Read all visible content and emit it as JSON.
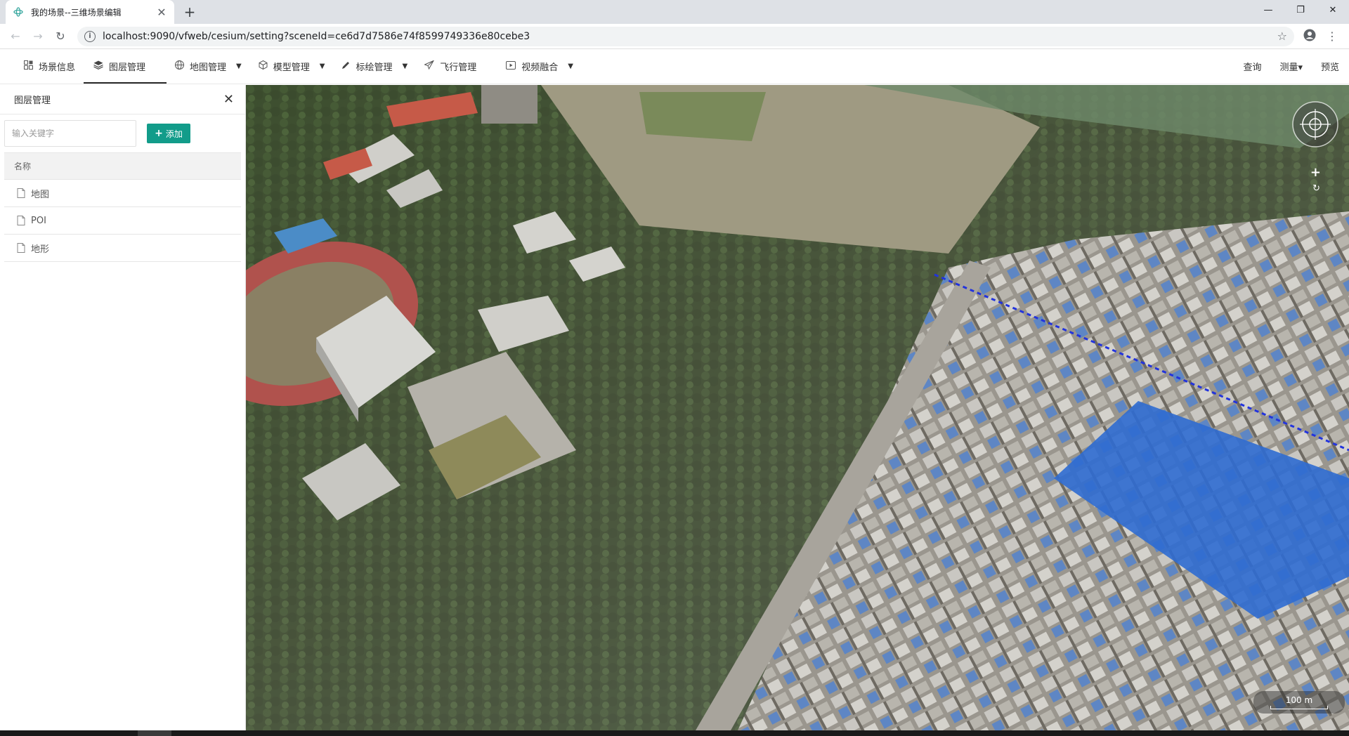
{
  "browser": {
    "tab_title": "我的场景--三维场景编辑",
    "tab_close": "✕",
    "new_tab": "+",
    "url": "localhost:9090/vfweb/cesium/setting?sceneId=ce6d7d7586e74f8599749336e80cebe3",
    "window_controls": [
      "—",
      "❐",
      "✕"
    ]
  },
  "toolbar": {
    "items": [
      {
        "label": "场景信息",
        "icon": "grid-icon"
      },
      {
        "label": "图层管理",
        "icon": "layers-icon"
      },
      {
        "label": "地图管理",
        "icon": "globe-icon"
      },
      {
        "label": "模型管理",
        "icon": "cube-icon"
      },
      {
        "label": "标绘管理",
        "icon": "pen-icon"
      },
      {
        "label": "飞行管理",
        "icon": "plane-icon"
      },
      {
        "label": "视频融合",
        "icon": "video-icon"
      }
    ],
    "right": {
      "query": "查询",
      "measure": "测量▾",
      "preview": "预览"
    }
  },
  "panel": {
    "title": "图层管理",
    "search_placeholder": "输入关键字",
    "add_label": "添加",
    "column_name": "名称",
    "rows": [
      "地图",
      "POI",
      "地形"
    ]
  },
  "map": {
    "scale_label": "100 m",
    "zoom_in": "+",
    "reset": "↻"
  },
  "colors": {
    "accent": "#129c8a"
  }
}
